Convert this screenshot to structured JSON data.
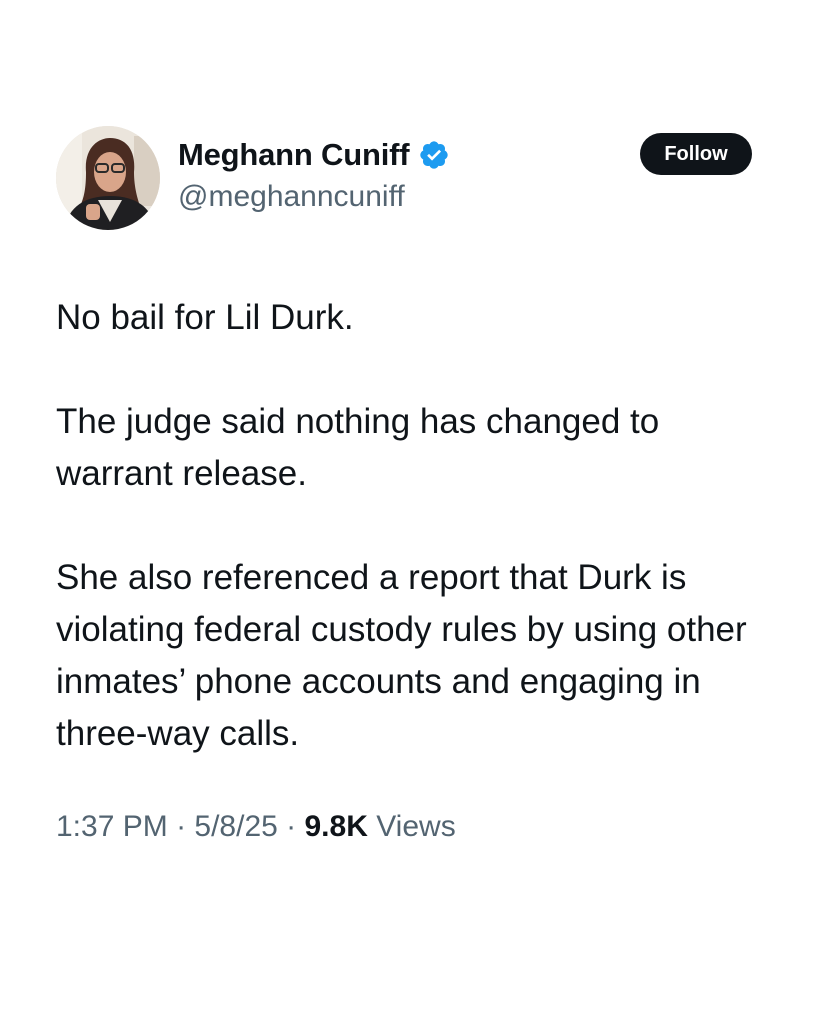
{
  "author": {
    "display_name": "Meghann Cuniff",
    "handle": "@meghanncuniff",
    "verified_icon": "verified-badge-icon",
    "avatar": "profile-photo"
  },
  "follow_button": {
    "label": "Follow"
  },
  "tweet": {
    "paragraphs": [
      "No bail for Lil Durk.",
      "The judge said nothing has changed to warrant release.",
      "She also referenced a report that Durk is violating federal custody rules by using other inmates’ phone accounts and engaging in three-way calls."
    ]
  },
  "meta": {
    "time": "1:37 PM",
    "separator": " · ",
    "date": "5/8/25",
    "views_count": "9.8K",
    "views_label": " Views"
  },
  "colors": {
    "text_primary": "#0f1419",
    "text_secondary": "#536471",
    "verified_blue": "#1d9bf0",
    "button_bg": "#0f1419"
  }
}
